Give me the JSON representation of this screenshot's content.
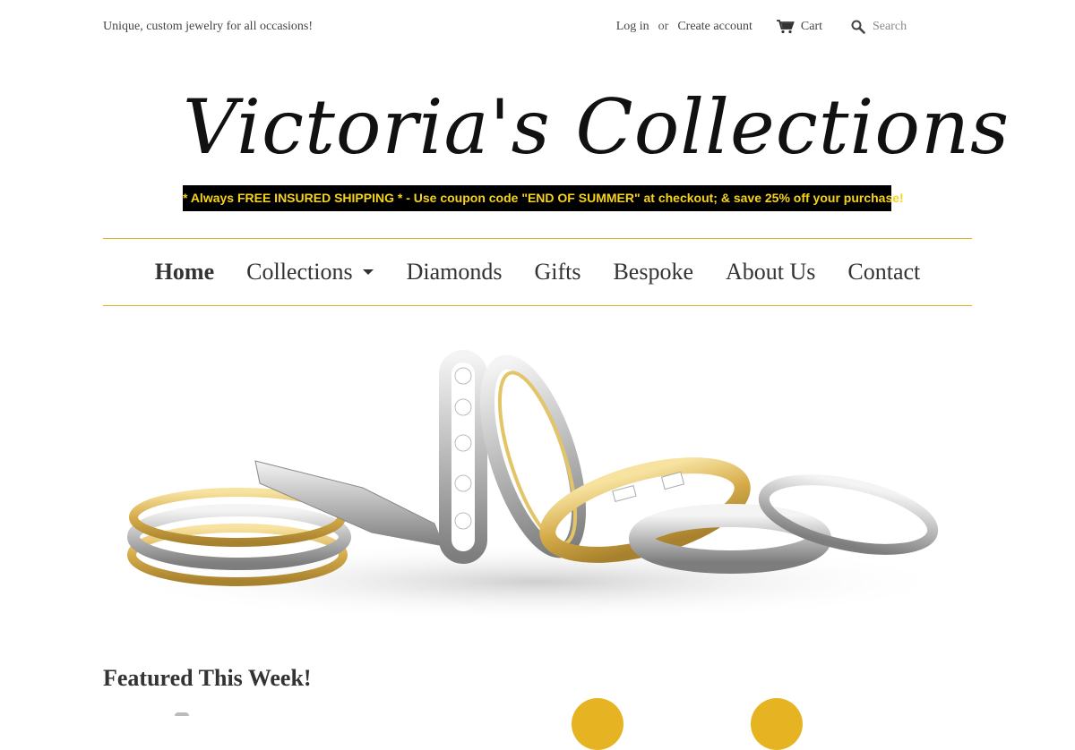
{
  "header": {
    "tagline": "Unique, custom jewelry for all occasions!",
    "login_label": "Log in",
    "or_label": "or",
    "create_account_label": "Create account",
    "cart_label": "Cart",
    "search_placeholder": "Search"
  },
  "logo": {
    "text": "Victoria's Collections"
  },
  "promo": {
    "text": "* Always FREE INSURED SHIPPING * - Use coupon code \"END OF SUMMER\" at checkout; & save 25% off your purchase!"
  },
  "nav": {
    "items": [
      {
        "label": "Home",
        "active": true
      },
      {
        "label": "Collections",
        "has_dropdown": true
      },
      {
        "label": "Diamonds"
      },
      {
        "label": "Gifts"
      },
      {
        "label": "Bespoke"
      },
      {
        "label": "About Us"
      },
      {
        "label": "Contact"
      }
    ]
  },
  "hero": {
    "icon": "rings-image"
  },
  "featured": {
    "title": "Featured This Week!"
  },
  "colors": {
    "accent": "#e0b12a",
    "promo_text": "#f5d21c",
    "promo_bg": "#000000"
  }
}
